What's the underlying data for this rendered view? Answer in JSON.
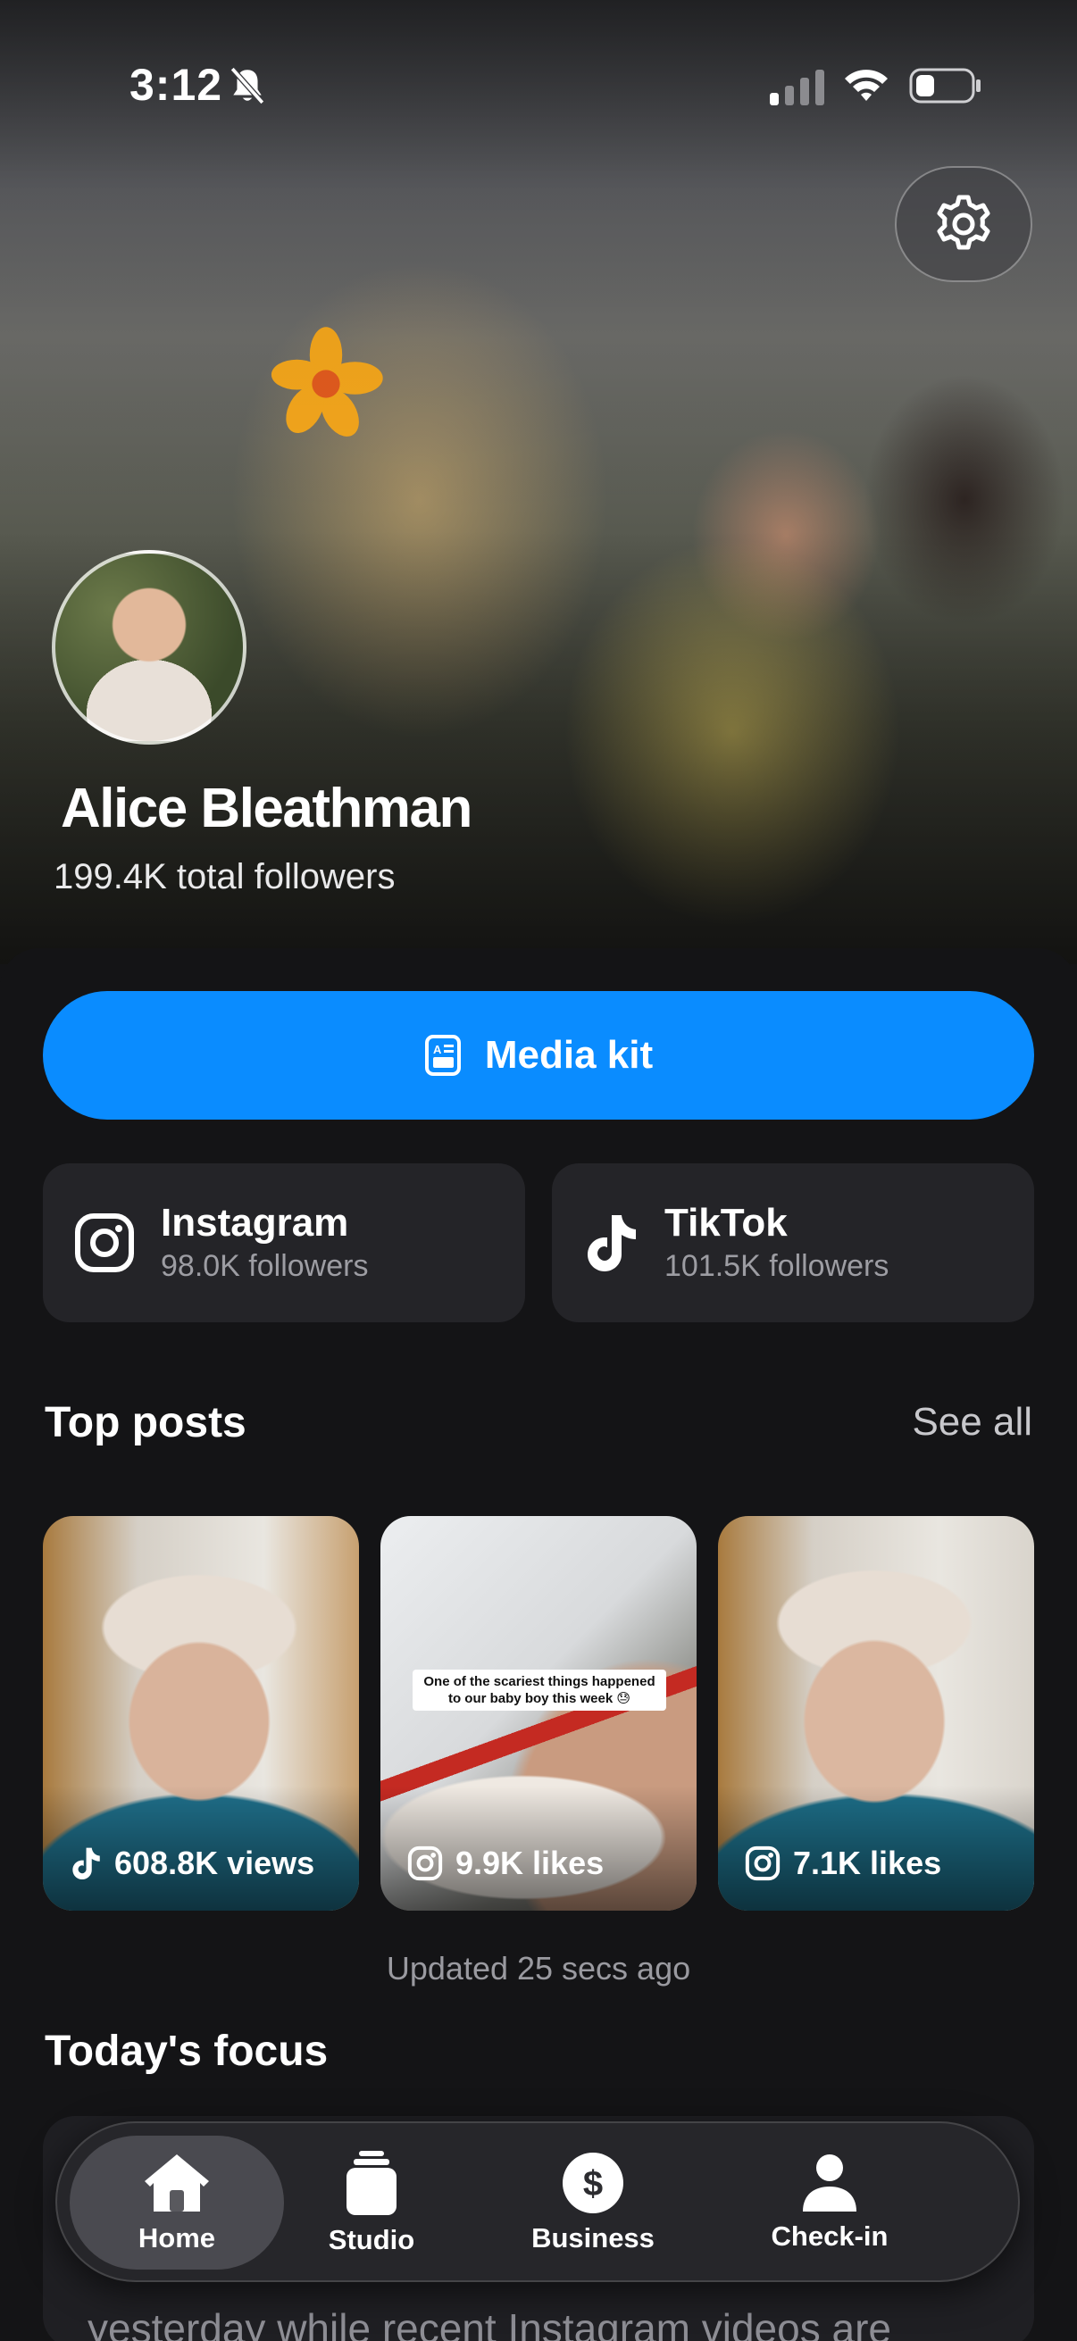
{
  "status_bar": {
    "time": "3:12"
  },
  "profile": {
    "name": "Alice Bleathman",
    "total_followers": "199.4K total followers"
  },
  "media_kit": {
    "label": "Media kit"
  },
  "platforms": [
    {
      "name": "Instagram",
      "followers": "98.0K followers",
      "icon": "instagram-icon"
    },
    {
      "name": "TikTok",
      "followers": "101.5K followers",
      "icon": "tiktok-icon"
    }
  ],
  "top_posts": {
    "title": "Top posts",
    "see_all": "See all",
    "posts": [
      {
        "stat": "608.8K views",
        "platform": "tiktok-icon",
        "caption": ""
      },
      {
        "stat": "9.9K likes",
        "platform": "instagram-icon",
        "caption": "One of the scariest things happened to our baby boy this week 😓"
      },
      {
        "stat": "7.1K likes",
        "platform": "instagram-icon",
        "caption": ""
      }
    ],
    "updated": "Updated 25 secs ago"
  },
  "focus": {
    "title": "Today's focus",
    "text": "yesterday while recent Instagram videos are"
  },
  "tabs": [
    {
      "label": "Home",
      "icon": "house-icon",
      "active": true
    },
    {
      "label": "Studio",
      "icon": "studio-icon",
      "active": false
    },
    {
      "label": "Business",
      "icon": "dollar-icon",
      "active": false
    },
    {
      "label": "Check-in",
      "icon": "person-icon",
      "active": false
    }
  ],
  "colors": {
    "accent": "#0A8CFF",
    "background": "#141416",
    "card": "#242428"
  }
}
